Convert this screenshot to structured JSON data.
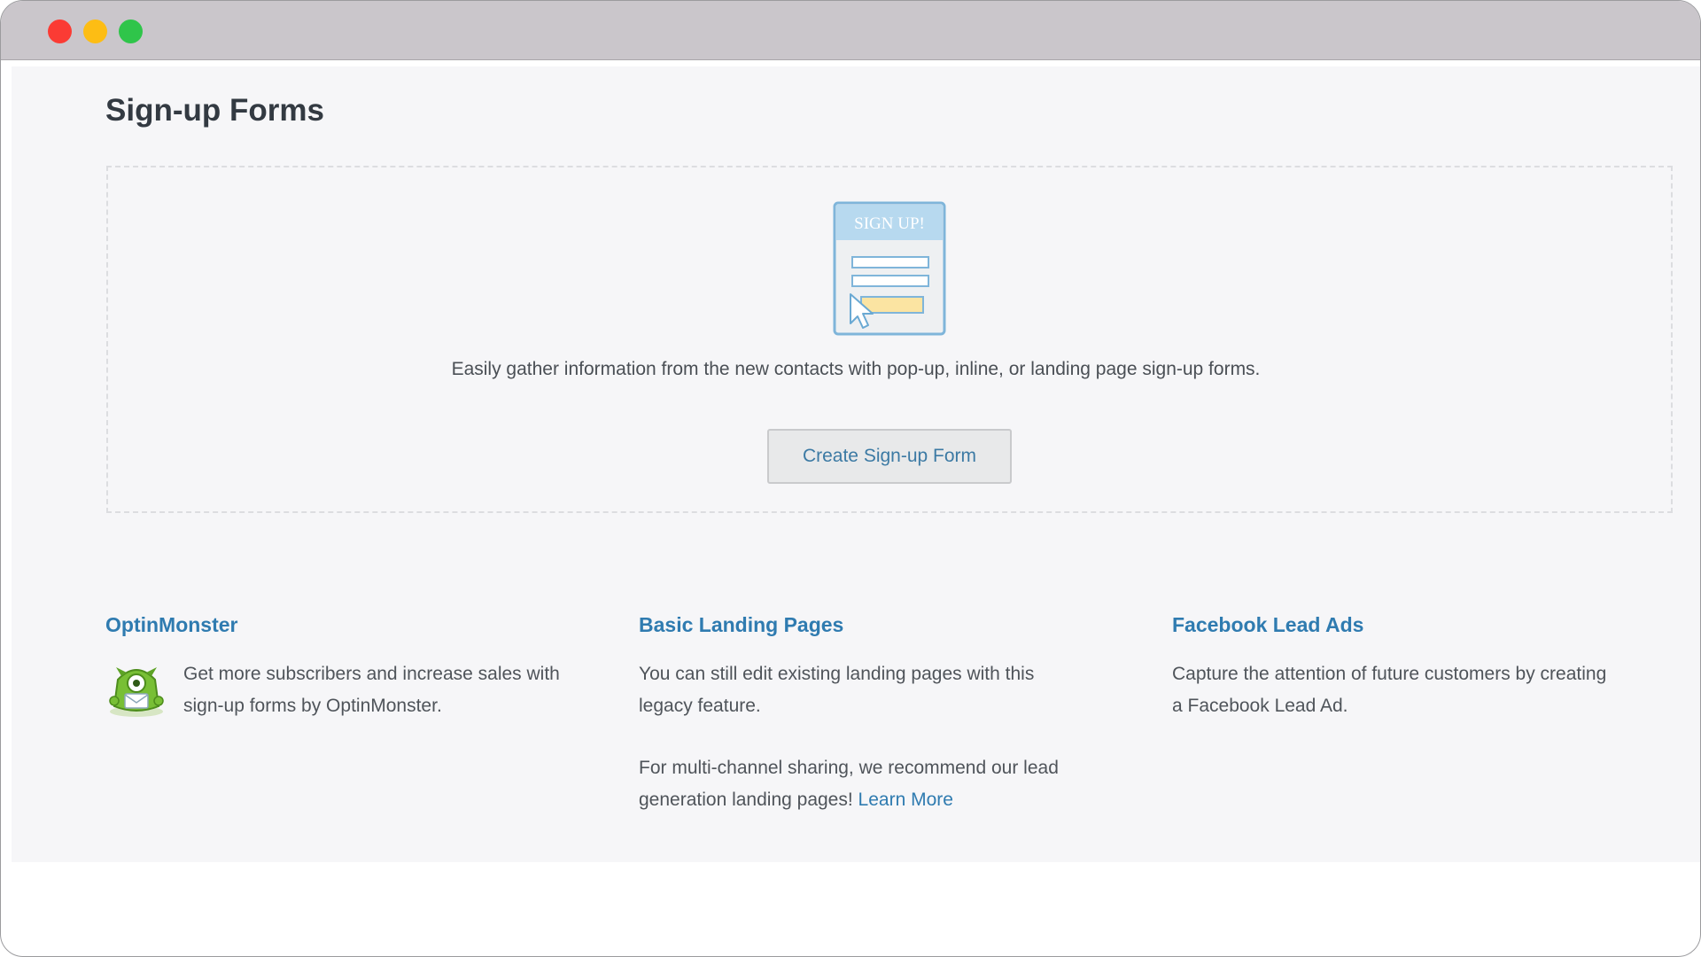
{
  "window": {
    "controls": [
      "close",
      "minimize",
      "maximize"
    ]
  },
  "page": {
    "title": "Sign-up Forms"
  },
  "empty_state": {
    "illustration_label": "SIGN UP!",
    "description": "Easily gather information from the new contacts with pop-up, inline, or landing page sign-up forms.",
    "button_label": "Create Sign-up Form"
  },
  "columns": [
    {
      "title": "OptinMonster",
      "icon": "optinmonster-icon",
      "text_line1": "Get more subscribers and increase sales with",
      "text_line2": "sign-up forms by OptinMonster."
    },
    {
      "title": "Basic Landing Pages",
      "text_line1": "You can still edit existing landing pages with this",
      "text_line2": "legacy feature.",
      "text_line3": "For multi-channel sharing, we recommend our lead",
      "text_line4": "generation landing pages!",
      "link_label": "Learn More"
    },
    {
      "title": "Facebook Lead Ads",
      "text_line1": "Capture the attention of future customers by creating",
      "text_line2": "a Facebook Lead Ad."
    }
  ],
  "colors": {
    "accent": "#2f7bb0",
    "background": "#f6f6f8",
    "titlebar": "#cac6cb"
  }
}
